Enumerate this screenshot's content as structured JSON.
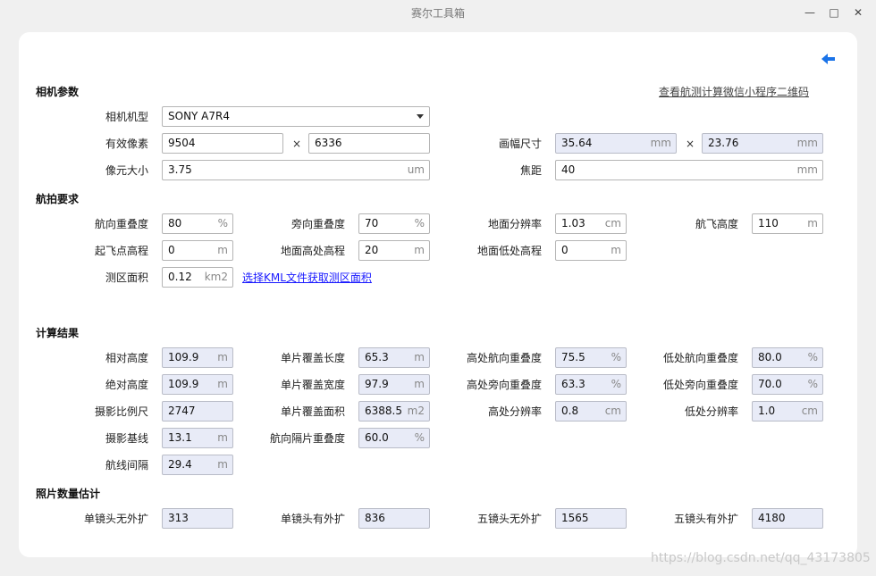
{
  "window": {
    "title": "赛尔工具箱",
    "minimize": "—",
    "maximize": "□",
    "close": "✕"
  },
  "top_link": "查看航测计算微信小程序二维码",
  "back_icon": "back-arrow-icon",
  "accent_color": "#1a73e8",
  "camera": {
    "section_title": "相机参数",
    "model_label": "相机机型",
    "model_value": "SONY A7R4",
    "pixels_label": "有效像素",
    "pixels_w": "9504",
    "times": "×",
    "pixels_h": "6336",
    "frame_label": "画幅尺寸",
    "frame_w": "35.64",
    "frame_w_unit": "mm",
    "frame_h": "23.76",
    "frame_h_unit": "mm",
    "pixel_size_label": "像元大小",
    "pixel_size": "3.75",
    "pixel_size_unit": "um",
    "focal_label": "焦距",
    "focal": "40",
    "focal_unit": "mm"
  },
  "requirements": {
    "section_title": "航拍要求",
    "forward_overlap_label": "航向重叠度",
    "forward_overlap": "80",
    "side_overlap_label": "旁向重叠度",
    "side_overlap": "70",
    "gsd_label": "地面分辨率",
    "gsd": "1.03",
    "gsd_unit": "cm",
    "flight_height_label": "航飞高度",
    "flight_height": "110",
    "takeoff_elev_label": "起飞点高程",
    "takeoff_elev": "0",
    "high_elev_label": "地面高处高程",
    "high_elev": "20",
    "low_elev_label": "地面低处高程",
    "low_elev": "0",
    "area_label": "测区面积",
    "area": "0.12",
    "area_unit": "km2",
    "kml_link": "选择KML文件获取测区面积",
    "percent": "%",
    "m": "m"
  },
  "results": {
    "section_title": "计算结果",
    "rel_height_label": "相对高度",
    "rel_height": "109.9",
    "single_len_label": "单片覆盖长度",
    "single_len": "65.3",
    "high_fwd_label": "高处航向重叠度",
    "high_fwd": "75.5",
    "low_fwd_label": "低处航向重叠度",
    "low_fwd": "80.0",
    "abs_height_label": "绝对高度",
    "abs_height": "109.9",
    "single_wid_label": "单片覆盖宽度",
    "single_wid": "97.9",
    "high_side_label": "高处旁向重叠度",
    "high_side": "63.3",
    "low_side_label": "低处旁向重叠度",
    "low_side": "70.0",
    "scale_label": "摄影比例尺",
    "scale": "2747",
    "single_area_label": "单片覆盖面积",
    "single_area": "6388.5",
    "single_area_unit": "m2",
    "high_gsd_label": "高处分辨率",
    "high_gsd": "0.8",
    "low_gsd_label": "低处分辨率",
    "low_gsd": "1.0",
    "baseline_label": "摄影基线",
    "baseline": "13.1",
    "fwd_skip_label": "航向隔片重叠度",
    "fwd_skip": "60.0",
    "line_spacing_label": "航线间隔",
    "line_spacing": "29.4",
    "cm": "cm",
    "percent": "%",
    "m": "m"
  },
  "photos": {
    "section_title": "照片数量估计",
    "single_no_ext_label": "单镜头无外扩",
    "single_no_ext": "313",
    "single_ext_label": "单镜头有外扩",
    "single_ext": "836",
    "five_no_ext_label": "五镜头无外扩",
    "five_no_ext": "1565",
    "five_ext_label": "五镜头有外扩",
    "five_ext": "4180"
  },
  "watermark": "https://blog.csdn.net/qq_43173805"
}
